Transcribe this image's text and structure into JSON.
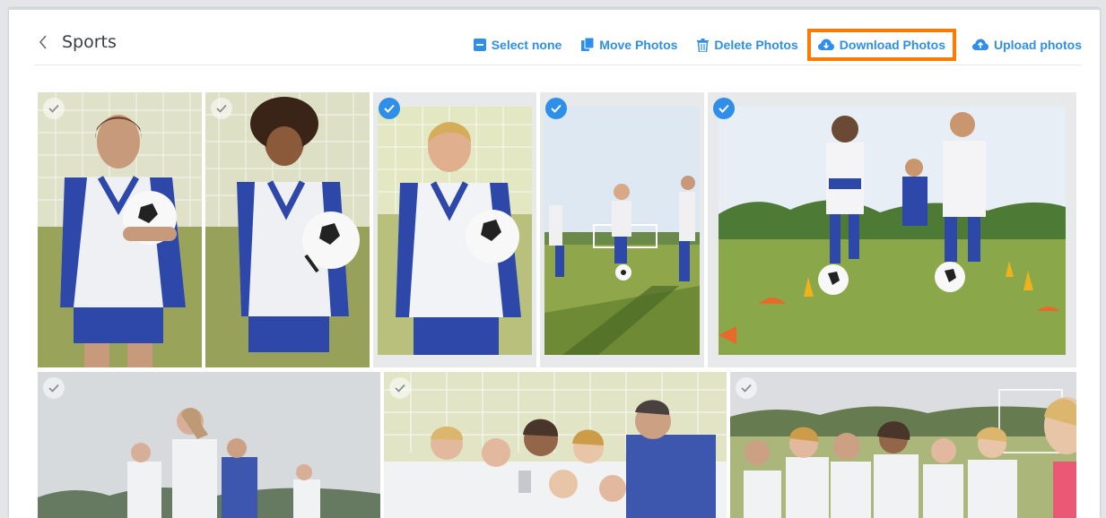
{
  "album": {
    "title": "Sports",
    "back_icon": "chevron-left-icon"
  },
  "actions": {
    "select_none": "Select none",
    "move": "Move Photos",
    "delete": "Delete Photos",
    "download": "Download Photos",
    "upload": "Upload photos"
  },
  "colors": {
    "accent": "#2f8fe8",
    "highlight": "#ff7a00"
  },
  "photos": [
    {
      "id": 1,
      "selected": false,
      "subject": "girl with soccer ball"
    },
    {
      "id": 2,
      "selected": false,
      "subject": "girl with soccer ball"
    },
    {
      "id": 3,
      "selected": true,
      "subject": "boy with soccer ball"
    },
    {
      "id": 4,
      "selected": true,
      "subject": "kids playing soccer"
    },
    {
      "id": 5,
      "selected": true,
      "subject": "soccer practice drill"
    },
    {
      "id": 6,
      "selected": false,
      "subject": "team on field"
    },
    {
      "id": 7,
      "selected": false,
      "subject": "team celebrating with coach"
    },
    {
      "id": 8,
      "selected": false,
      "subject": "team sitting on field"
    }
  ]
}
